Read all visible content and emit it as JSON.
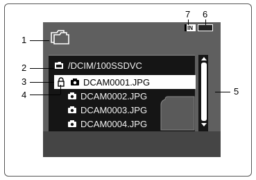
{
  "callouts": {
    "c1": "1",
    "c2": "2",
    "c3": "3",
    "c4": "4",
    "c5": "5",
    "c6": "6",
    "c7": "7"
  },
  "status": {
    "memory_label": "IN"
  },
  "browser": {
    "path": "/DCIM/100SSDVC",
    "files": [
      {
        "name": "DCAM0001.JPG",
        "selected": true,
        "protected": true
      },
      {
        "name": "DCAM0002.JPG",
        "selected": false,
        "protected": false
      },
      {
        "name": "DCAM0003.JPG",
        "selected": false,
        "protected": false
      },
      {
        "name": "DCAM0004.JPG",
        "selected": false,
        "protected": false
      }
    ]
  }
}
